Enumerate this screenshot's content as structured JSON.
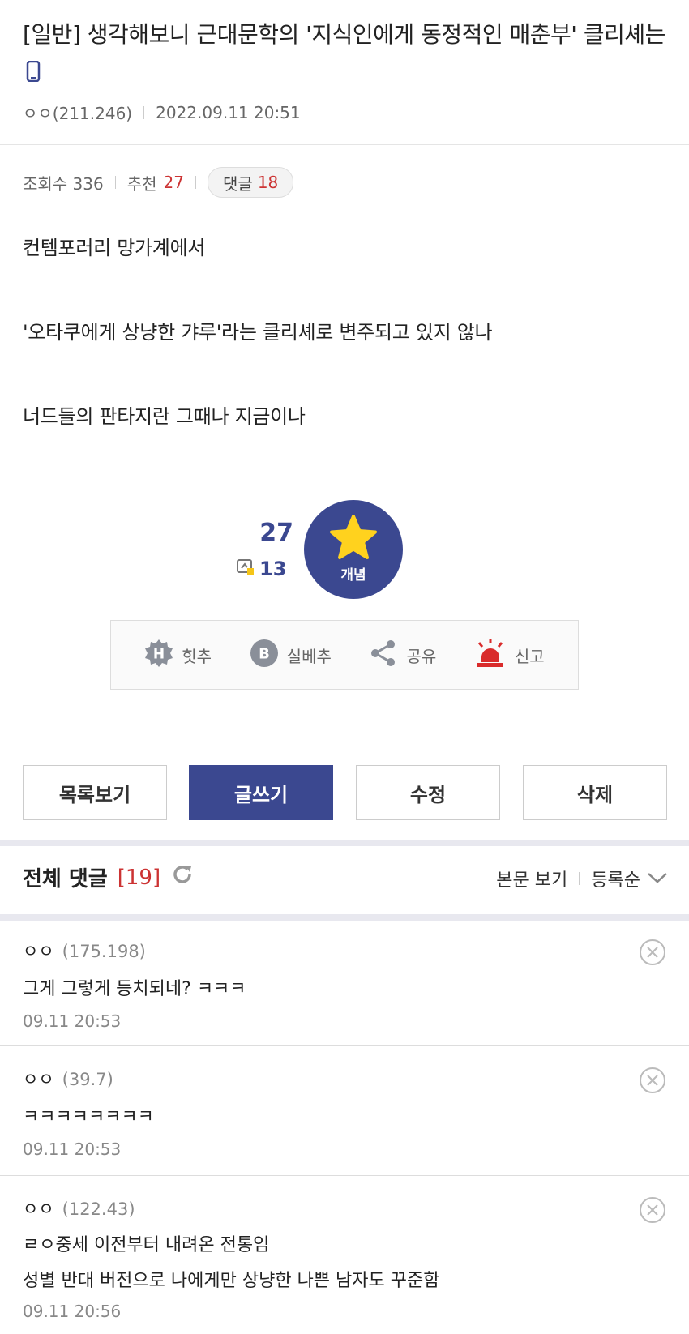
{
  "post": {
    "title": "[일반] 생각해보니 근대문학의 '지식인에게 동정적인 매춘부' 클리셰는",
    "author": "ㅇㅇ(211.246)",
    "date": "2022.09.11 20:51",
    "views_label": "조회수 336",
    "recommend_label": "추천",
    "recommend_count": "27",
    "comment_label": "댓글",
    "comment_count": "18",
    "body": [
      "컨템포러리 망가계에서",
      "'오타쿠에게 상냥한 갸루'라는 클리셰로 변주되고 있지 않나",
      "너드들의 판타지란 그때나 지금이나"
    ]
  },
  "recommend": {
    "count": "27",
    "fixed_count": "13",
    "button_label": "개념"
  },
  "actions": {
    "hit": "힛추",
    "silbe": "실베추",
    "share": "공유",
    "report": "신고"
  },
  "buttons": {
    "list": "목록보기",
    "write": "글쓰기",
    "edit": "수정",
    "delete": "삭제"
  },
  "comments_section": {
    "title": "전체 댓글",
    "count": "[19]",
    "view_body": "본문 보기",
    "sort": "등록순"
  },
  "comments": [
    {
      "nick": "ㅇㅇ",
      "ip": "(175.198)",
      "lines": [
        "그게 그렇게 등치되네? ㅋㅋㅋ"
      ],
      "time": "09.11 20:53"
    },
    {
      "nick": "ㅇㅇ",
      "ip": "(39.7)",
      "lines": [
        "ㅋㅋㅋㅋㅋㅋㅋㅋ"
      ],
      "time": "09.11 20:53"
    },
    {
      "nick": "ㅇㅇ",
      "ip": "(122.43)",
      "lines": [
        "ㄹㅇ중세 이전부터 내려온 전통임",
        "성별 반대 버전으로 나에게만 상냥한 나쁜 남자도 꾸준함"
      ],
      "time": "09.11 20:56"
    }
  ],
  "colors": {
    "brand": "#3b4890",
    "accent_red": "#cc3333",
    "star": "#ffd21e"
  }
}
